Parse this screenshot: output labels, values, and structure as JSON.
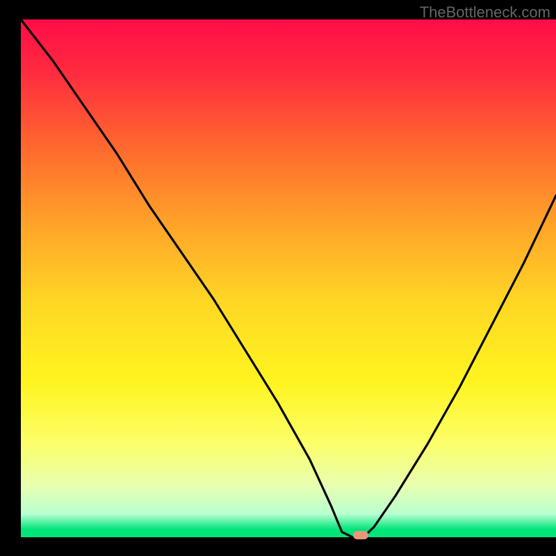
{
  "watermark": "TheBottleneck.com",
  "chart_data": {
    "type": "line",
    "title": "",
    "xlabel": "",
    "ylabel": "",
    "xlim": [
      0,
      100
    ],
    "ylim": [
      0,
      100
    ],
    "gradient_stops": [
      {
        "pos": 0.0,
        "color": "#ff0d47"
      },
      {
        "pos": 0.1,
        "color": "#ff2a3f"
      },
      {
        "pos": 0.25,
        "color": "#ff6a2e"
      },
      {
        "pos": 0.4,
        "color": "#ffa529"
      },
      {
        "pos": 0.55,
        "color": "#ffd824"
      },
      {
        "pos": 0.7,
        "color": "#fff41f"
      },
      {
        "pos": 0.82,
        "color": "#fbff6a"
      },
      {
        "pos": 0.9,
        "color": "#e8ffb0"
      },
      {
        "pos": 0.955,
        "color": "#b8ffd0"
      },
      {
        "pos": 0.985,
        "color": "#00e47a"
      },
      {
        "pos": 1.0,
        "color": "#00e47a"
      }
    ],
    "series": [
      {
        "name": "bottleneck-curve",
        "x": [
          0,
          6,
          12,
          18,
          24,
          30,
          36,
          42,
          48,
          54,
          58,
          60,
          62,
          63,
          64,
          66,
          70,
          76,
          82,
          88,
          94,
          100
        ],
        "y": [
          100,
          92,
          83,
          74,
          64,
          55,
          46,
          36,
          26,
          15,
          6,
          1,
          0,
          0,
          0,
          2,
          8,
          18,
          29,
          41,
          53,
          66
        ]
      }
    ],
    "marker": {
      "x": 63.5,
      "y": 0,
      "color": "#e9967a"
    }
  }
}
